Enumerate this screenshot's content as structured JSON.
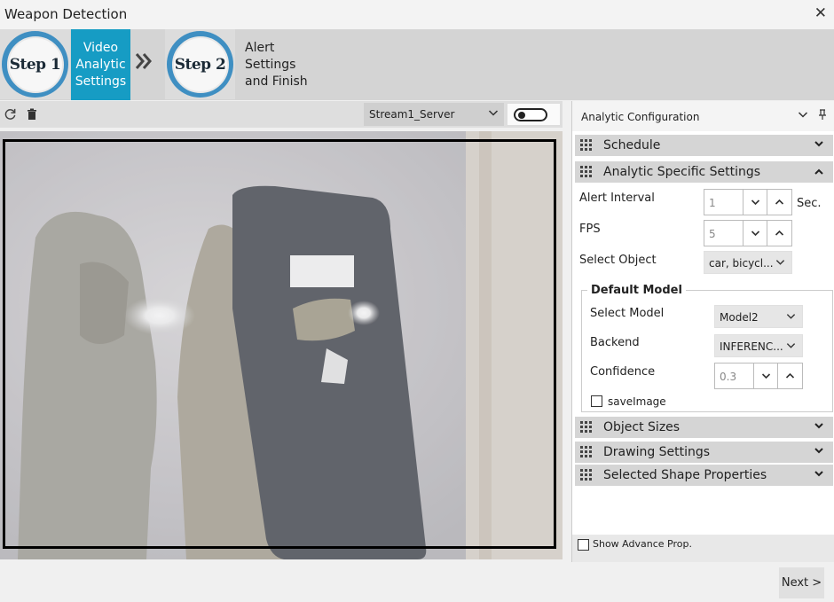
{
  "window": {
    "title": "Weapon Detection",
    "close_glyph": "✕"
  },
  "wizard": {
    "step1": {
      "badge": "Step 1",
      "label": "Video Analytic Settings",
      "label_lines": [
        "Video",
        "Analytic",
        "Settings"
      ],
      "active": true
    },
    "separator_glyph": "»",
    "step2": {
      "badge": "Step 2",
      "label": "Alert Settings and Finish",
      "label_lines": [
        "Alert",
        "Settings",
        "and Finish"
      ],
      "active": false
    }
  },
  "video_toolbar": {
    "refresh_icon": "refresh-icon",
    "delete_icon": "trash-icon",
    "stream": "Stream1_Server",
    "toggle_on": false
  },
  "panel": {
    "title": "Analytic Configuration",
    "sections": {
      "schedule": "Schedule",
      "analytic_specific": "Analytic Specific Settings",
      "object_sizes": "Object Sizes",
      "drawing_settings": "Drawing Settings",
      "selected_shape": "Selected Shape Properties"
    },
    "alert_interval": {
      "label": "Alert Interval",
      "value": "1",
      "unit": "Sec."
    },
    "fps": {
      "label": "FPS",
      "value": "5"
    },
    "select_object": {
      "label": "Select Object",
      "value": "car, bicycl..."
    },
    "default_model": {
      "legend": "Default Model",
      "select_model": {
        "label": "Select Model",
        "value": "Model2"
      },
      "backend": {
        "label": "Backend",
        "value": "INFERENC..."
      },
      "confidence": {
        "label": "Confidence",
        "value": "0.3"
      },
      "save_image": {
        "label": "saveImage",
        "checked": false
      }
    },
    "show_advance": {
      "label": "Show Advance Prop.",
      "checked": false
    }
  },
  "footer": {
    "next": "Next >"
  },
  "colors": {
    "active_step": "#169cc4",
    "badge_ring": "#3f8fc2",
    "section_bar": "#d5d5d5"
  }
}
